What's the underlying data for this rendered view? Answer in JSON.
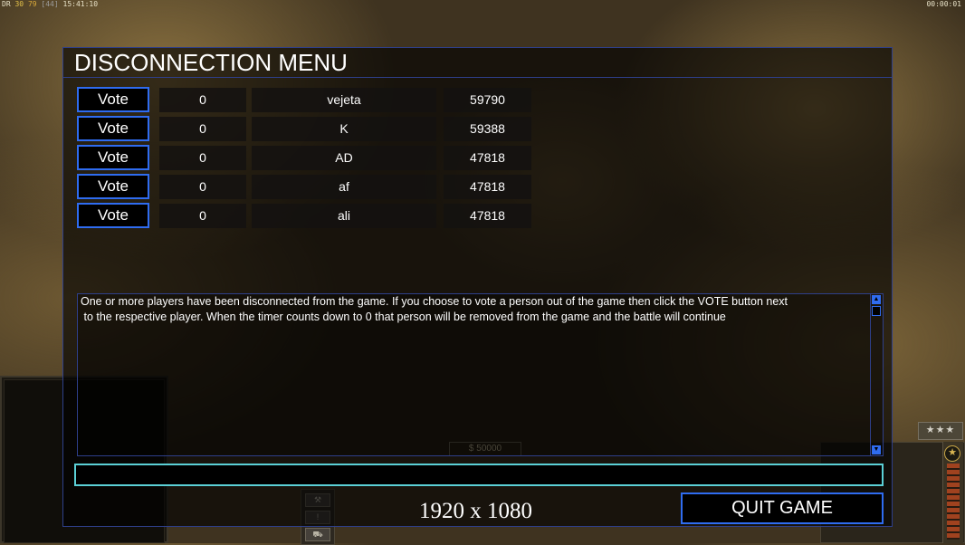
{
  "hud": {
    "top_left": {
      "prefix": "DR",
      "a": "30",
      "b": "79",
      "c": "[44]",
      "time": "15:41:10"
    },
    "top_right_timer": "00:00:01",
    "money_ghost": "$ 50000",
    "rank_stars": "★★★",
    "rank_emblem": "★",
    "bottom_buttons": [
      "⚒",
      "!",
      "⛟"
    ]
  },
  "dialog": {
    "title": "DISCONNECTION MENU",
    "players": [
      {
        "vote_label": "Vote",
        "count": "0",
        "name": "vejeta",
        "ping": "59790"
      },
      {
        "vote_label": "Vote",
        "count": "0",
        "name": "K",
        "ping": "59388"
      },
      {
        "vote_label": "Vote",
        "count": "0",
        "name": "AD",
        "ping": "47818"
      },
      {
        "vote_label": "Vote",
        "count": "0",
        "name": "af",
        "ping": "47818"
      },
      {
        "vote_label": "Vote",
        "count": "0",
        "name": "ali",
        "ping": "47818"
      }
    ],
    "message_line1": "One or more players have been disconnected from the game. If you choose to vote a person out of the game then click the VOTE button next",
    "message_line2": " to the respective player. When the timer counts down to 0 that person will be removed from the game and the battle will continue",
    "chat_value": "",
    "quit_label": "QUIT GAME"
  },
  "resolution_label": "1920 x 1080",
  "colors": {
    "accent_blue": "#2f6cf0",
    "chat_border": "#5bd0d6",
    "frame": "#2e3f8a"
  }
}
